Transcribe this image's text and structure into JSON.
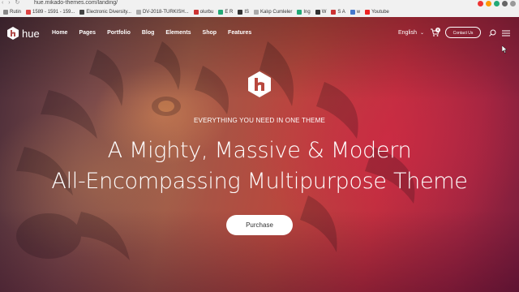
{
  "browser": {
    "url": "hue.mikado-themes.com/landing/",
    "bookmarks": [
      {
        "label": "Rutin",
        "color": "#888888"
      },
      {
        "label": "1589 - 1591 - 159...",
        "color": "#d44"
      },
      {
        "label": "Electronic Diversity...",
        "color": "#444"
      },
      {
        "label": "DV-2018-TURKISH...",
        "color": "#aaa"
      },
      {
        "label": "olurbu",
        "color": "#c33"
      },
      {
        "label": "E R",
        "color": "#2a7"
      },
      {
        "label": "IS",
        "color": "#333"
      },
      {
        "label": "Kalıp Cumleler",
        "color": "#aaa"
      },
      {
        "label": "Ing",
        "color": "#2a7"
      },
      {
        "label": "W",
        "color": "#333"
      },
      {
        "label": "S A",
        "color": "#c33"
      },
      {
        "label": "w",
        "color": "#47c"
      },
      {
        "label": "Youtube",
        "color": "#e22"
      }
    ]
  },
  "header": {
    "logo_text": "hue",
    "nav": [
      "Home",
      "Pages",
      "Portfolio",
      "Blog",
      "Elements",
      "Shop",
      "Features"
    ],
    "language": "English",
    "cart_count": "0",
    "contact_label": "Contact Us"
  },
  "hero": {
    "tagline": "EVERYTHING YOU NEED IN ONE THEME",
    "headline_line1": "A Mighty, Massive & Modern",
    "headline_line2": "All-Encompassing Multipurpose Theme",
    "cta_label": "Purchase"
  },
  "colors": {
    "accent": "#c0303f",
    "text": "#ffffff"
  }
}
